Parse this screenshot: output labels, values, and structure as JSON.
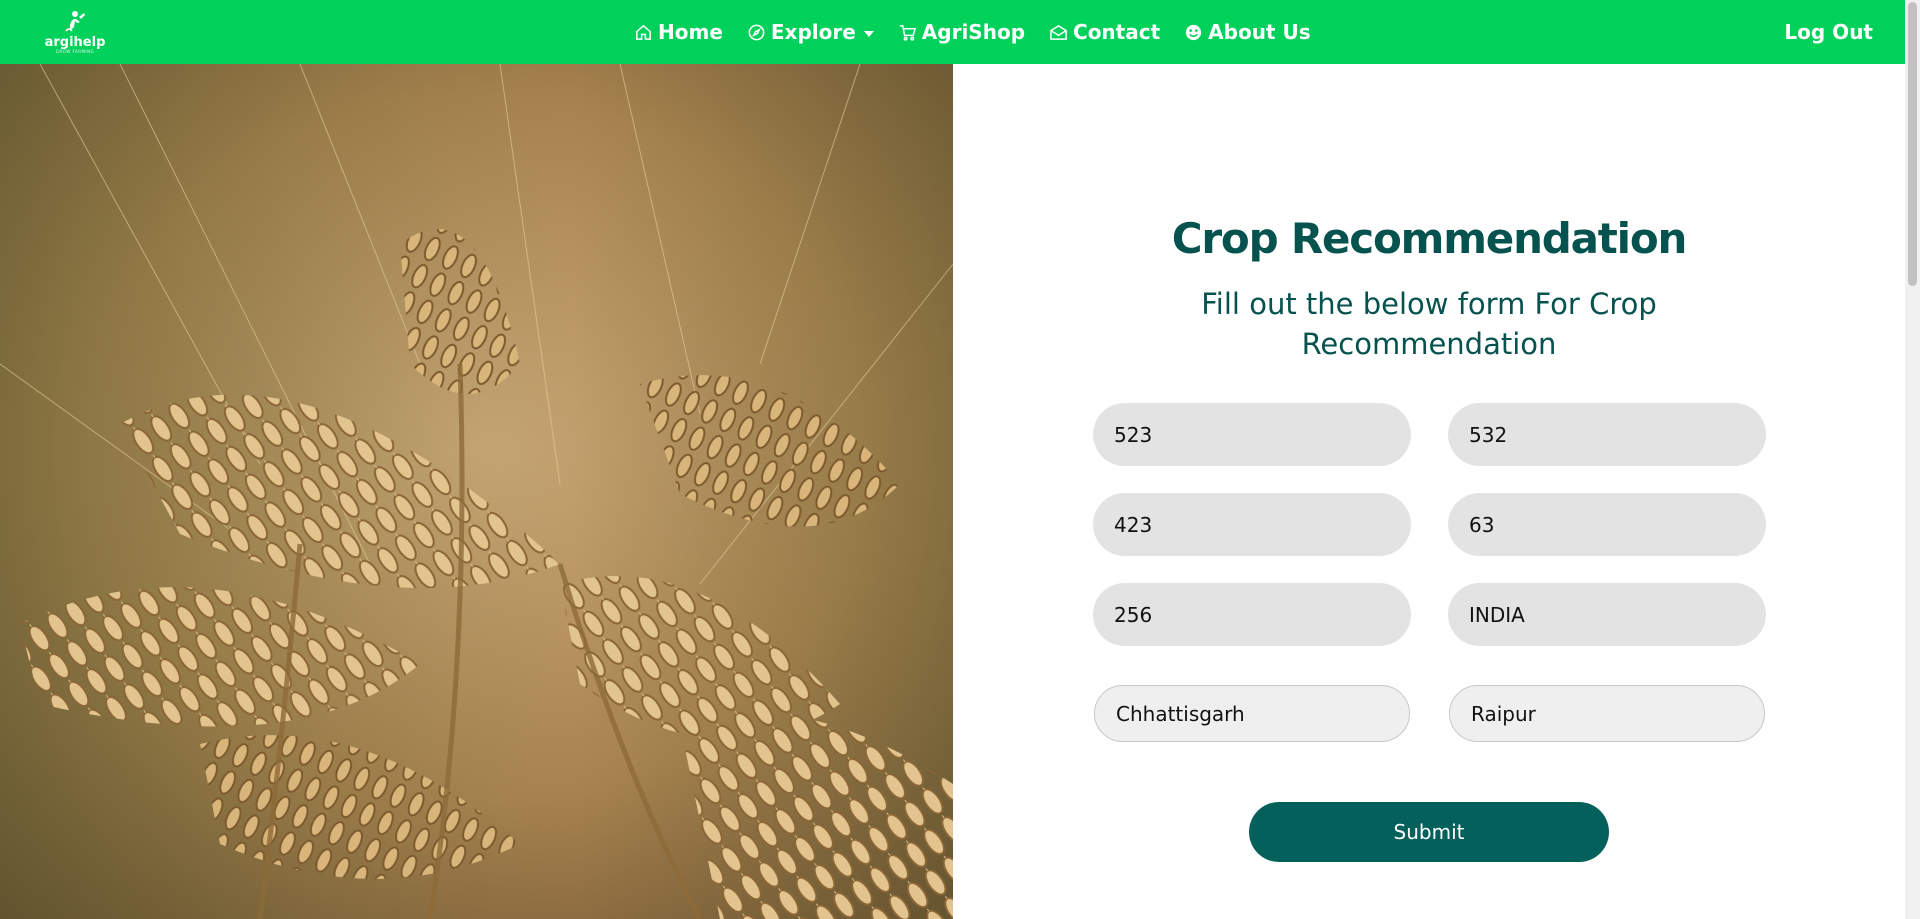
{
  "brand": {
    "name": "argihelp",
    "tagline": "GROW FARMING"
  },
  "nav": {
    "items": [
      {
        "label": "Home",
        "icon": "home-icon"
      },
      {
        "label": "Explore",
        "icon": "compass-icon"
      },
      {
        "label": "AgriShop",
        "icon": "cart-icon"
      },
      {
        "label": "Contact",
        "icon": "envelope-icon"
      },
      {
        "label": "About Us",
        "icon": "smiley-icon"
      }
    ],
    "logout": "Log Out"
  },
  "form": {
    "title": "Crop Recommendation",
    "subtitle": "Fill out the below form For Crop Recommendation",
    "fields": [
      "523",
      "532",
      "423",
      "63",
      "256",
      "INDIA",
      "Chhattisgarh",
      "Raipur"
    ],
    "submit": "Submit"
  },
  "colors": {
    "navbar": "#00d15a",
    "heading": "#06524e",
    "button": "#03605b",
    "field": "#e3e3e3"
  }
}
